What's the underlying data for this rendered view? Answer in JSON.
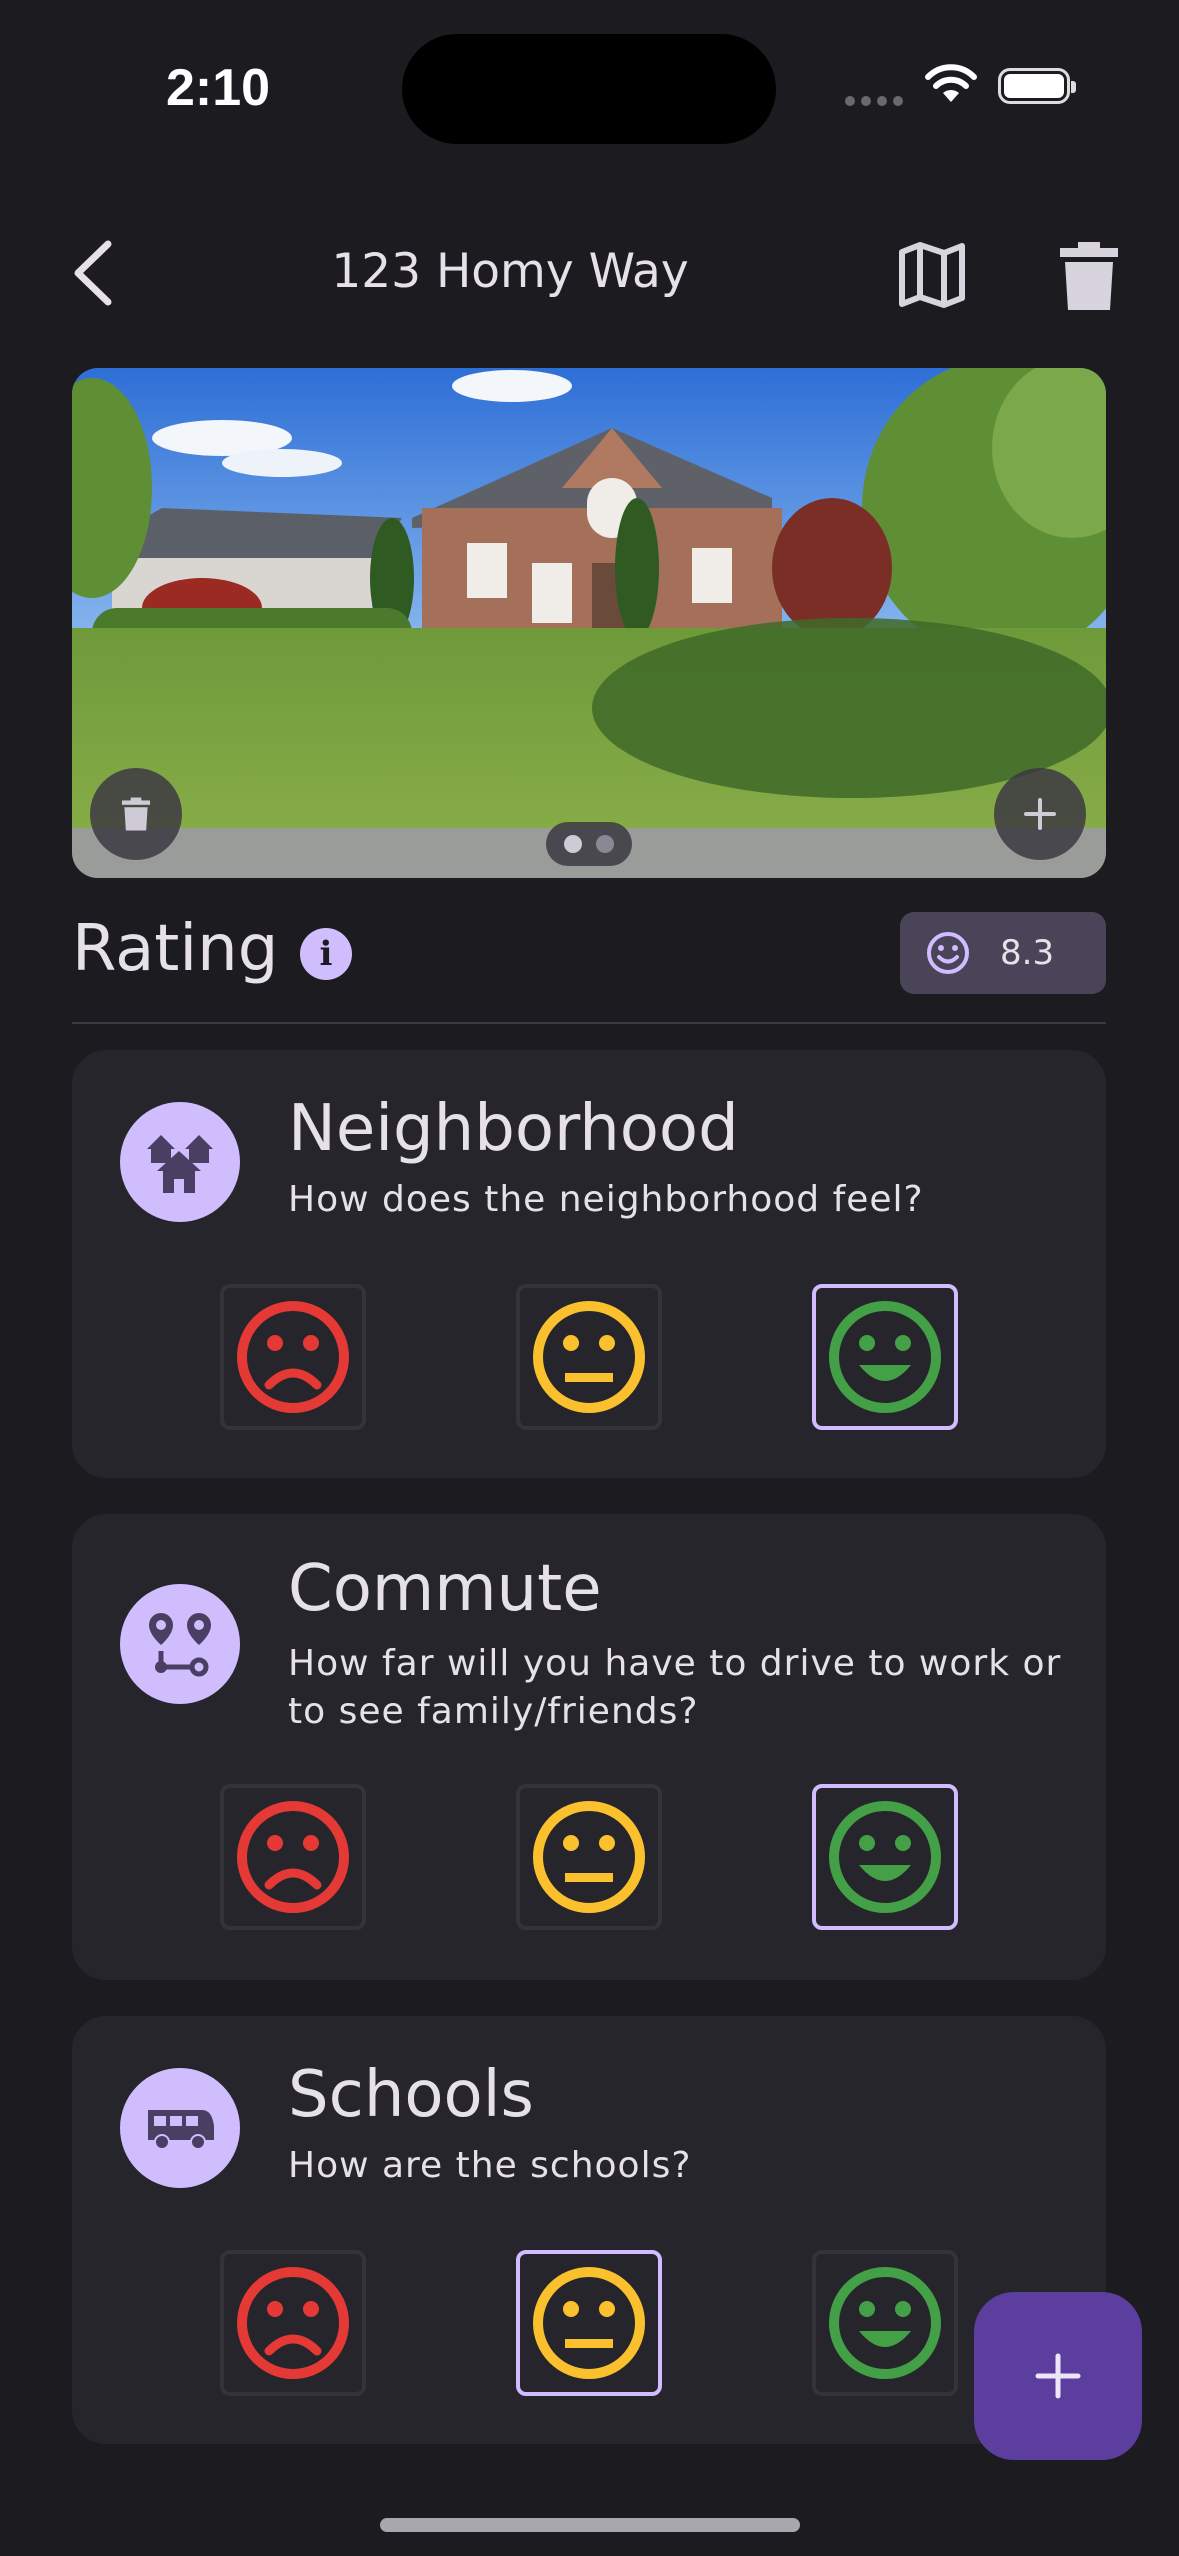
{
  "status_bar": {
    "time": "2:10"
  },
  "app_bar": {
    "title": "123 Homy Way"
  },
  "rating": {
    "label": "Rating",
    "info_glyph": "i",
    "score": "8.3"
  },
  "categories": [
    {
      "title": "Neighborhood",
      "subtitle": "How does the neighborhood feel?",
      "icon": "houses-icon",
      "selected": "happy"
    },
    {
      "title": "Commute",
      "subtitle": "How far will you have to drive to work or to see family/friends?",
      "icon": "route-icon",
      "selected": "happy"
    },
    {
      "title": "Schools",
      "subtitle": "How are the schools?",
      "icon": "bus-icon",
      "selected": "neutral"
    }
  ],
  "colors": {
    "background": "#1c1b20",
    "card": "#26252b",
    "accent": "#cfbdfe",
    "fab": "#5b3e9e",
    "sad": "#e53935",
    "neutral": "#fbc02d",
    "happy": "#43a047"
  }
}
